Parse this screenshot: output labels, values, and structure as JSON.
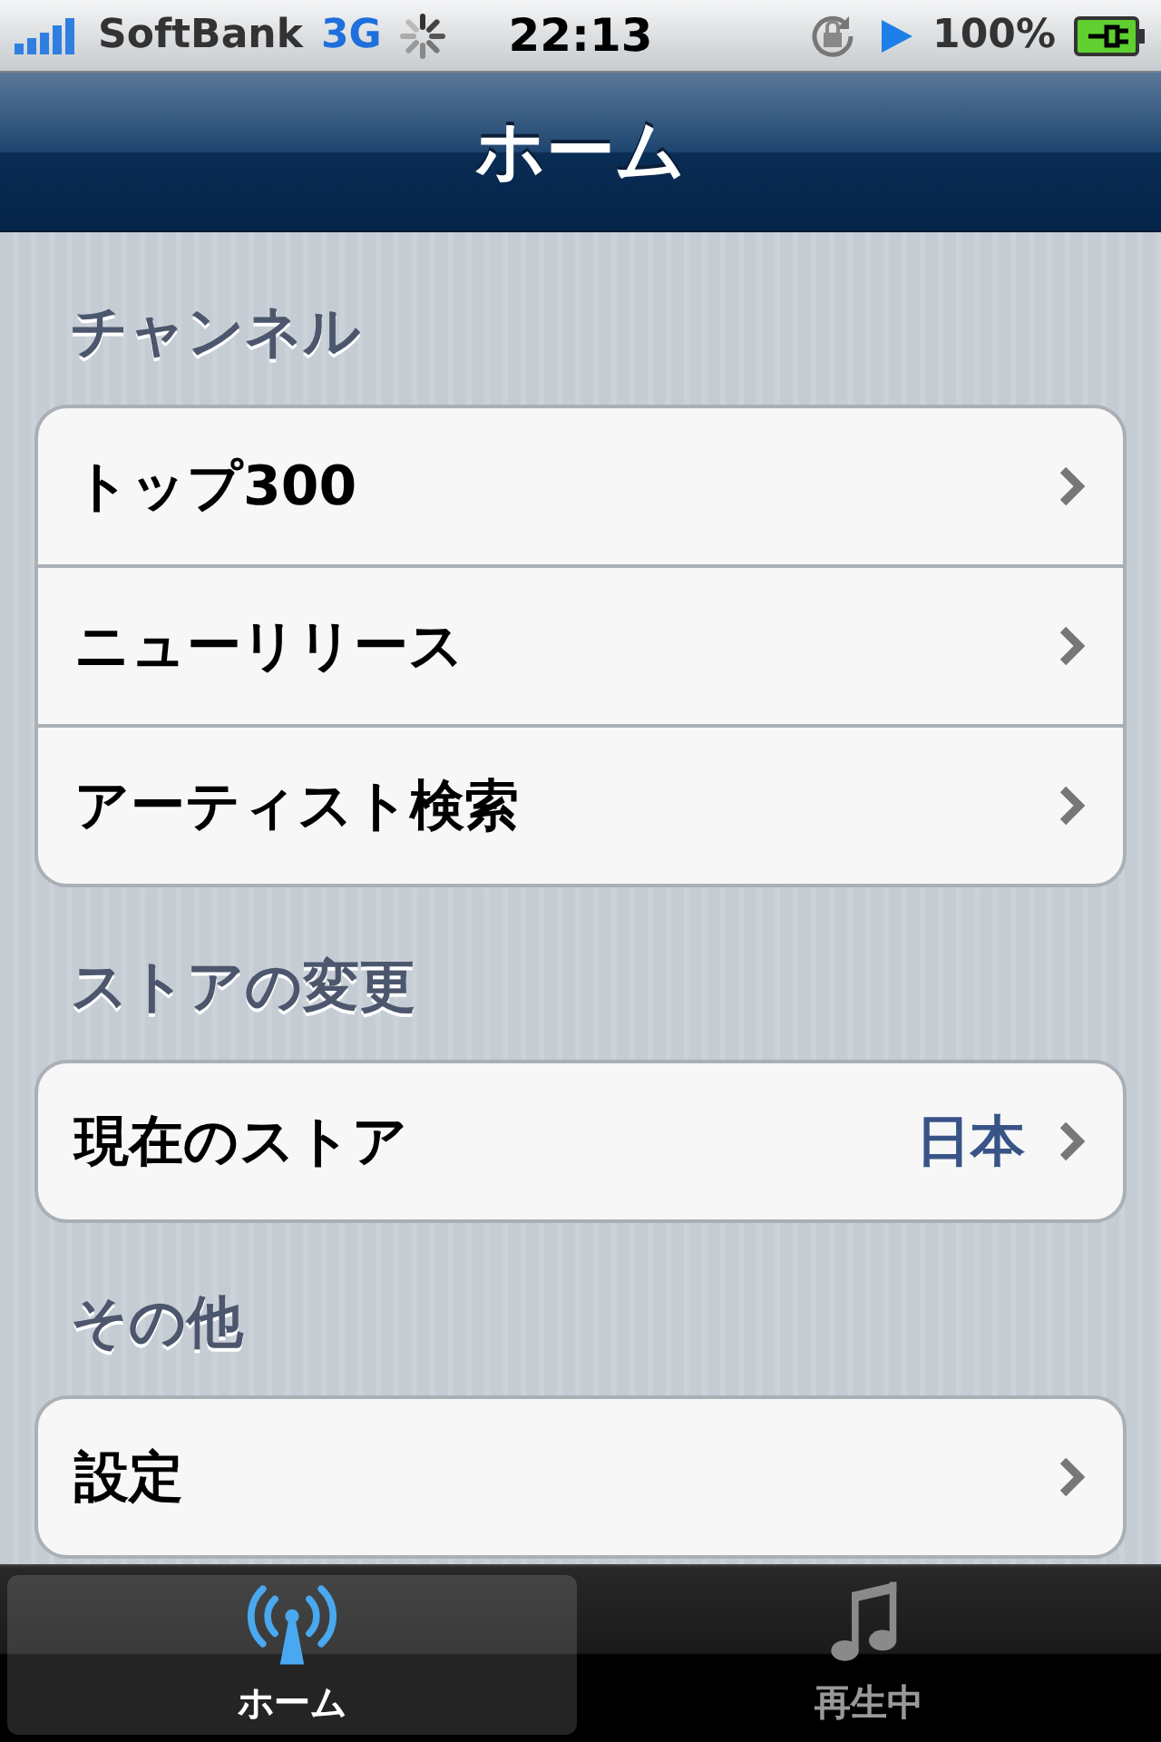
{
  "status_bar": {
    "carrier": "SoftBank",
    "network": "3G",
    "time": "22:13",
    "battery": "100%"
  },
  "nav_bar": {
    "title": "ホーム"
  },
  "sections": [
    {
      "title": "チャンネル",
      "rows": [
        {
          "label": "トップ300"
        },
        {
          "label": "ニューリリース"
        },
        {
          "label": "アーティスト検索"
        }
      ]
    },
    {
      "title": "ストアの変更",
      "rows": [
        {
          "label": "現在のストア",
          "value": "日本"
        }
      ]
    },
    {
      "title": "その他",
      "rows": [
        {
          "label": "設定"
        }
      ]
    }
  ],
  "tab_bar": [
    {
      "label": "ホーム",
      "kind": "antenna",
      "selected": true
    },
    {
      "label": "再生中",
      "kind": "music",
      "selected": false
    }
  ]
}
